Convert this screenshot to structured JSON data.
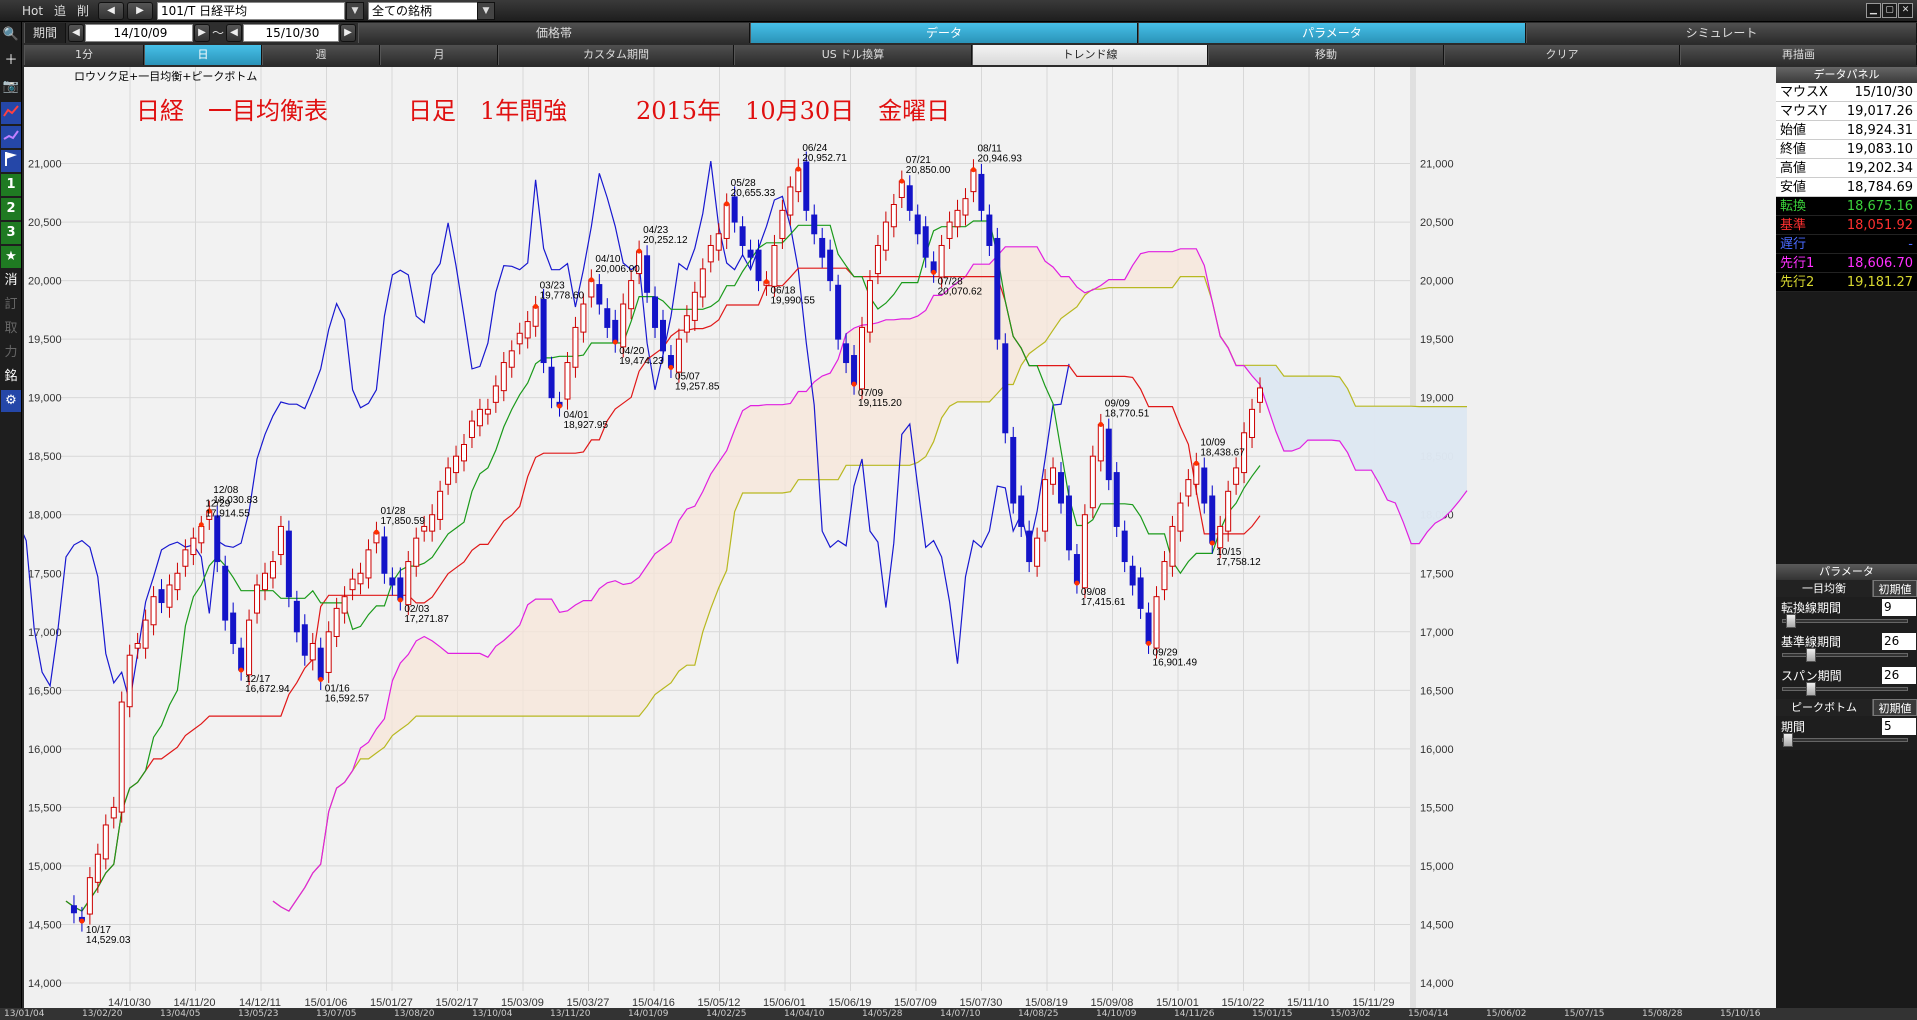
{
  "topbar": {
    "hot": "Hot",
    "add": "追",
    "del": "削",
    "symbol": "101/T 日経平均",
    "filter": "全ての銘柄",
    "period_label": "期間",
    "from_date": "14/10/09",
    "to_date": "15/10/30",
    "tilde": "～"
  },
  "tabs_row1": [
    "価格帯",
    "データ",
    "パラメータ",
    "シミュレート"
  ],
  "tabs_row2": [
    "1分",
    "日",
    "週",
    "月",
    "カスタム期間",
    "US ドル換算",
    "トレンド線",
    "移動",
    "クリア",
    "再描画"
  ],
  "left_tools": [
    "🔍",
    "＋",
    "📷",
    "",
    "",
    "",
    "1",
    "2",
    "3",
    "★",
    "消",
    "訂",
    "取",
    "力",
    "銘",
    "⚙"
  ],
  "chart": {
    "caption": "ロウソク足+一目均衡+ピークボトム",
    "title_parts": [
      "日経　一目均衡表",
      "日足　1年間強",
      "2015年　10月30日　金曜日"
    ]
  },
  "chart_data": {
    "type": "candlestick-ichimoku",
    "ylim": [
      14000,
      21500
    ],
    "yticks": [
      14000,
      14500,
      15000,
      15500,
      16000,
      16500,
      17000,
      17500,
      18000,
      18500,
      19000,
      19500,
      20000,
      20500,
      21000
    ],
    "yticklabels": [
      "14,000",
      "14,500",
      "15,000",
      "15,500",
      "16,000",
      "16,500",
      "17,000",
      "17,500",
      "18,000",
      "18,500",
      "19,000",
      "19,500",
      "20,000",
      "20,500",
      "21,000"
    ],
    "xticks": [
      "14/10/30",
      "14/11/20",
      "14/12/11",
      "15/01/06",
      "15/01/27",
      "15/02/17",
      "15/03/09",
      "15/03/27",
      "15/04/16",
      "15/05/12",
      "15/06/01",
      "15/06/19",
      "15/07/09",
      "15/07/30",
      "15/08/19",
      "15/09/08",
      "15/10/01",
      "15/10/22",
      "15/11/10",
      "15/11/29"
    ],
    "peaks": [
      {
        "date": "10/17",
        "value": "14,529.03",
        "kind": "bottom"
      },
      {
        "date": "12/08",
        "value": "18,030.83",
        "kind": "peak"
      },
      {
        "date": "12/17",
        "value": "16,672.94",
        "kind": "bottom"
      },
      {
        "date": "12/29",
        "value": "17,914.55",
        "kind": "peak"
      },
      {
        "date": "01/16",
        "value": "16,592.57",
        "kind": "bottom"
      },
      {
        "date": "01/28",
        "value": "17,850.59",
        "kind": "peak"
      },
      {
        "date": "02/03",
        "value": "17,271.87",
        "kind": "bottom"
      },
      {
        "date": "03/23",
        "value": "19,778.60",
        "kind": "peak"
      },
      {
        "date": "04/01",
        "value": "18,927.95",
        "kind": "bottom"
      },
      {
        "date": "04/10",
        "value": "20,006.00",
        "kind": "peak"
      },
      {
        "date": "04/20",
        "value": "19,474.23",
        "kind": "bottom"
      },
      {
        "date": "04/23",
        "value": "20,252.12",
        "kind": "peak"
      },
      {
        "date": "05/07",
        "value": "19,257.85",
        "kind": "bottom"
      },
      {
        "date": "05/28",
        "value": "20,655.33",
        "kind": "peak"
      },
      {
        "date": "06/18",
        "value": "19,990.55",
        "kind": "bottom"
      },
      {
        "date": "06/24",
        "value": "20,952.71",
        "kind": "peak"
      },
      {
        "date": "07/09",
        "value": "19,115.20",
        "kind": "bottom"
      },
      {
        "date": "07/21",
        "value": "20,850.00",
        "kind": "peak"
      },
      {
        "date": "07/28",
        "value": "20,070.62",
        "kind": "bottom"
      },
      {
        "date": "08/11",
        "value": "20,946.93",
        "kind": "peak"
      },
      {
        "date": "09/08",
        "value": "17,415.61",
        "kind": "bottom"
      },
      {
        "date": "09/09",
        "value": "18,770.51",
        "kind": "peak"
      },
      {
        "date": "09/29",
        "value": "16,901.49",
        "kind": "bottom"
      },
      {
        "date": "10/09",
        "value": "18,438.67",
        "kind": "peak"
      },
      {
        "date": "10/15",
        "value": "17,758.12",
        "kind": "bottom"
      }
    ],
    "close_path": [
      14700,
      14600,
      14529,
      14900,
      15100,
      15350,
      15500,
      16400,
      16800,
      16900,
      17100,
      17300,
      17250,
      17400,
      17500,
      17700,
      17800,
      17900,
      18030,
      17600,
      17100,
      16900,
      16673,
      17100,
      17400,
      17500,
      17600,
      17900,
      17300,
      17000,
      16800,
      16900,
      16593,
      17000,
      17200,
      17300,
      17450,
      17500,
      17700,
      17850,
      17500,
      17400,
      17272,
      17600,
      17800,
      17900,
      18000,
      18200,
      18400,
      18500,
      18600,
      18800,
      18900,
      18900,
      19100,
      19300,
      19400,
      19550,
      19650,
      19779,
      19300,
      19000,
      18928,
      19300,
      19600,
      19800,
      20006,
      19800,
      19600,
      19474,
      19800,
      20000,
      20252,
      19900,
      19600,
      19400,
      19258,
      19500,
      19700,
      19900,
      20100,
      20300,
      20400,
      20655,
      20500,
      20300,
      20200,
      20000,
      19991,
      20300,
      20600,
      20800,
      20953,
      20600,
      20400,
      20200,
      20000,
      19500,
      19300,
      19115,
      19600,
      20000,
      20300,
      20500,
      20650,
      20850,
      20600,
      20400,
      20200,
      20071,
      20300,
      20500,
      20600,
      20700,
      20947,
      20600,
      20300,
      19500,
      18700,
      18100,
      17900,
      17600,
      17800,
      18300,
      18400,
      18100,
      17700,
      17416,
      18000,
      18500,
      18771,
      18300,
      17900,
      17600,
      17400,
      17200,
      16901,
      17300,
      17600,
      17900,
      18100,
      18300,
      18439,
      18100,
      17758,
      17900,
      18200,
      18400,
      18700,
      18900,
      19083
    ],
    "series": [
      {
        "name": "転換",
        "color": "#1a9a1a"
      },
      {
        "name": "基準",
        "color": "#e01818"
      },
      {
        "name": "遅行",
        "color": "#1818d0"
      },
      {
        "name": "先行1",
        "color": "#e020e0"
      },
      {
        "name": "先行2",
        "color": "#b8b820"
      }
    ]
  },
  "datapanel": {
    "header": "データパネル",
    "rows": [
      {
        "label": "マウスX",
        "value": "15/10/30"
      },
      {
        "label": "マウスY",
        "value": "19,017.26"
      },
      {
        "label": "始値",
        "value": "18,924.31"
      },
      {
        "label": "終値",
        "value": "19,083.10"
      },
      {
        "label": "高値",
        "value": "19,202.34"
      },
      {
        "label": "安値",
        "value": "18,784.69"
      }
    ],
    "ichimoku": [
      {
        "label": "転換",
        "value": "18,675.16",
        "color": "#3ad13a"
      },
      {
        "label": "基準",
        "value": "18,051.92",
        "color": "#ff3030"
      },
      {
        "label": "遅行",
        "value": "-",
        "color": "#4a6aff"
      },
      {
        "label": "先行1",
        "value": "18,606.70",
        "color": "#ff30ff"
      },
      {
        "label": "先行2",
        "value": "19,181.27",
        "color": "#d8d830"
      }
    ]
  },
  "params": {
    "title": "パラメータ",
    "ichimoku_section": "一目均衡",
    "reset": "初期値",
    "items": [
      {
        "label": "転換線期間",
        "value": "9",
        "pos": 0.03
      },
      {
        "label": "基準線期間",
        "value": "26",
        "pos": 0.2
      },
      {
        "label": "スパン期間",
        "value": "26",
        "pos": 0.2
      }
    ],
    "peak_section": "ピークボトム",
    "reset2": "初期値",
    "peak_items": [
      {
        "label": "期間",
        "value": "5",
        "pos": 0.0
      }
    ]
  },
  "datebar": [
    "13/01/04",
    "13/02/20",
    "13/04/05",
    "13/05/23",
    "13/07/05",
    "13/08/20",
    "13/10/04",
    "13/11/20",
    "14/01/09",
    "14/02/25",
    "14/04/10",
    "14/05/28",
    "14/07/10",
    "14/08/25",
    "14/10/09",
    "14/11/26",
    "15/01/15",
    "15/03/02",
    "15/04/14",
    "15/06/02",
    "15/07/15",
    "15/08/28",
    "15/10/16"
  ]
}
